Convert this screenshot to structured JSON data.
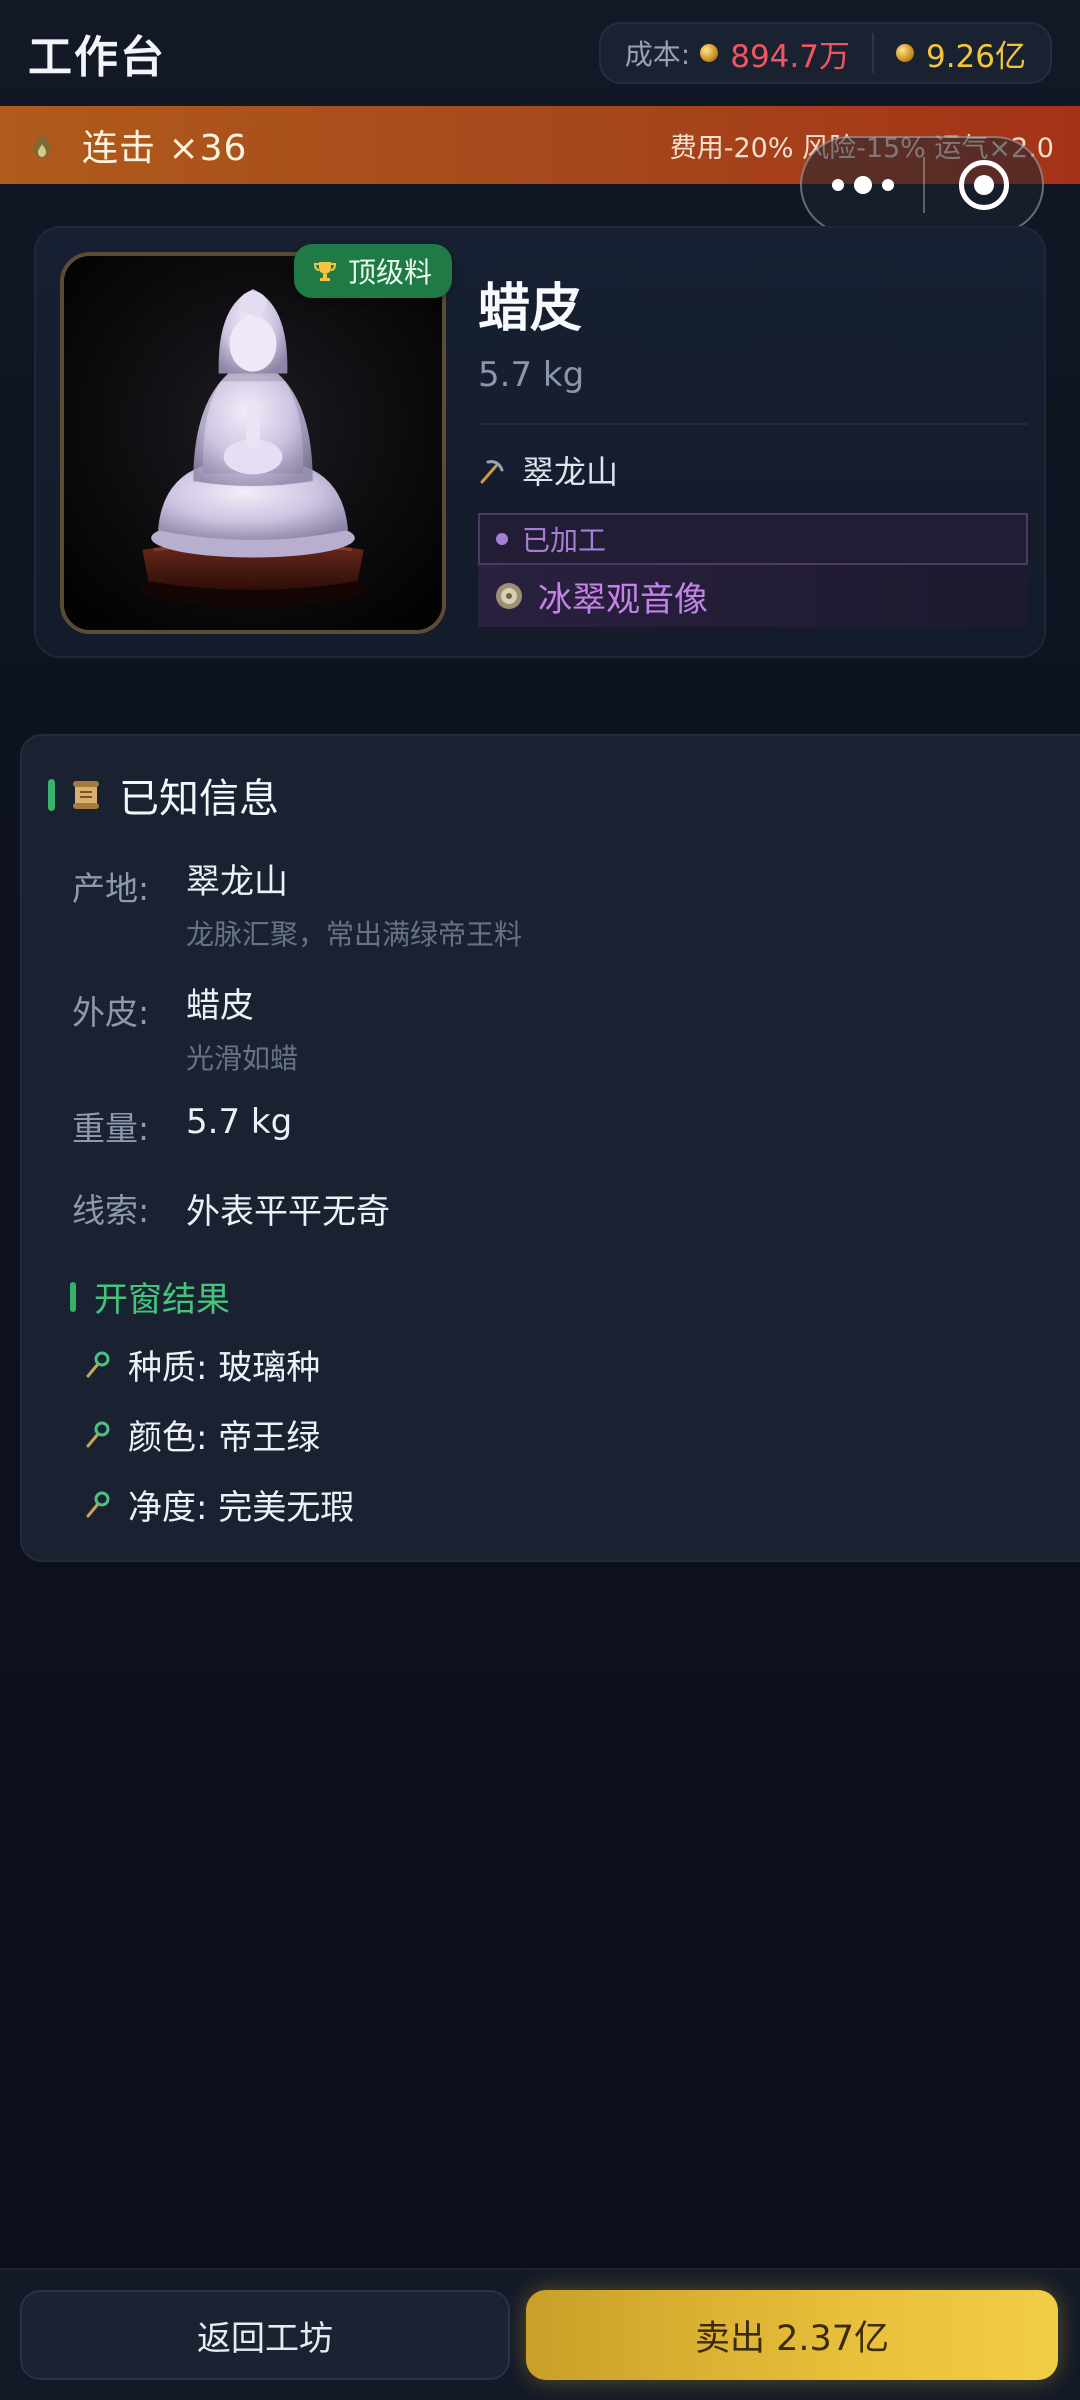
{
  "header": {
    "title": "工作台",
    "cost_label": "成本:",
    "cost_value": "894.7万",
    "money_value": "9.26亿"
  },
  "combo": {
    "label": "连击 ×36",
    "modifiers": "费用-20% 风险-15% 运气×2.0"
  },
  "item": {
    "badge": "顶级料",
    "name": "蜡皮",
    "weight": "5.7 kg",
    "origin": "翠龙山",
    "status": "已加工",
    "product": "冰翠观音像"
  },
  "known_info": {
    "title": "已知信息",
    "fields": [
      {
        "label": "产地:",
        "value": "翠龙山",
        "note": "龙脉汇聚，常出满绿帝王料"
      },
      {
        "label": "外皮:",
        "value": "蜡皮",
        "note": "光滑如蜡"
      },
      {
        "label": "重量:",
        "value": "5.7 kg"
      },
      {
        "label": "线索:",
        "value": "外表平平无奇"
      }
    ],
    "window_result": {
      "title": "开窗结果",
      "items": [
        "种质: 玻璃种",
        "颜色: 帝王绿",
        "净度: 完美无瑕"
      ]
    }
  },
  "actions": {
    "back": "返回工坊",
    "sell": "卖出 2.37亿"
  },
  "colors": {
    "accent_green": "#36b26a",
    "cost_red": "#f2555f",
    "gold": "#f3c53a",
    "purple": "#c483e8"
  }
}
